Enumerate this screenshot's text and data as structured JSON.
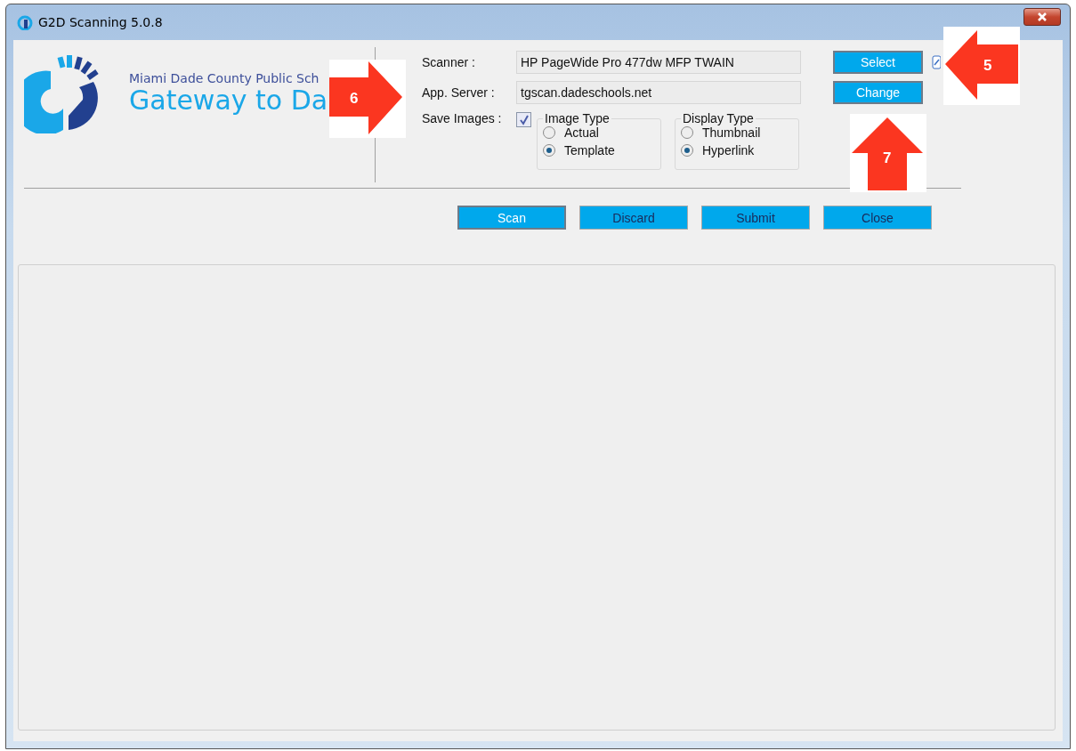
{
  "window": {
    "title": "G2D Scanning 5.0.8"
  },
  "brand": {
    "subtitle": "Miami Dade County Public Sch",
    "name": "Gateway to Da"
  },
  "fields": [
    {
      "label": "Scanner :",
      "value": "HP PageWide Pro 477dw MFP TWAIN",
      "button": {
        "label": "Select",
        "default": true
      }
    },
    {
      "label": "App. Server :",
      "value": "tgscan.dadeschools.net",
      "button": {
        "label": "Change",
        "default": true
      }
    }
  ],
  "save_images": {
    "label": "Save Images :",
    "checked": true
  },
  "groups": [
    {
      "title": "Image Type",
      "options": [
        {
          "label": "Actual",
          "selected": false
        },
        {
          "label": "Template",
          "selected": true
        }
      ]
    },
    {
      "title": "Display Type",
      "options": [
        {
          "label": "Thumbnail",
          "selected": false
        },
        {
          "label": "Hyperlink",
          "selected": true
        }
      ]
    }
  ],
  "buttons": [
    {
      "label": "Scan",
      "default": true
    },
    {
      "label": "Discard",
      "default": false
    },
    {
      "label": "Submit",
      "default": false
    },
    {
      "label": "Close",
      "default": false
    }
  ],
  "callouts": [
    {
      "number": "5",
      "kind": "left"
    },
    {
      "number": "6",
      "kind": "right"
    },
    {
      "number": "7",
      "kind": "up"
    }
  ]
}
